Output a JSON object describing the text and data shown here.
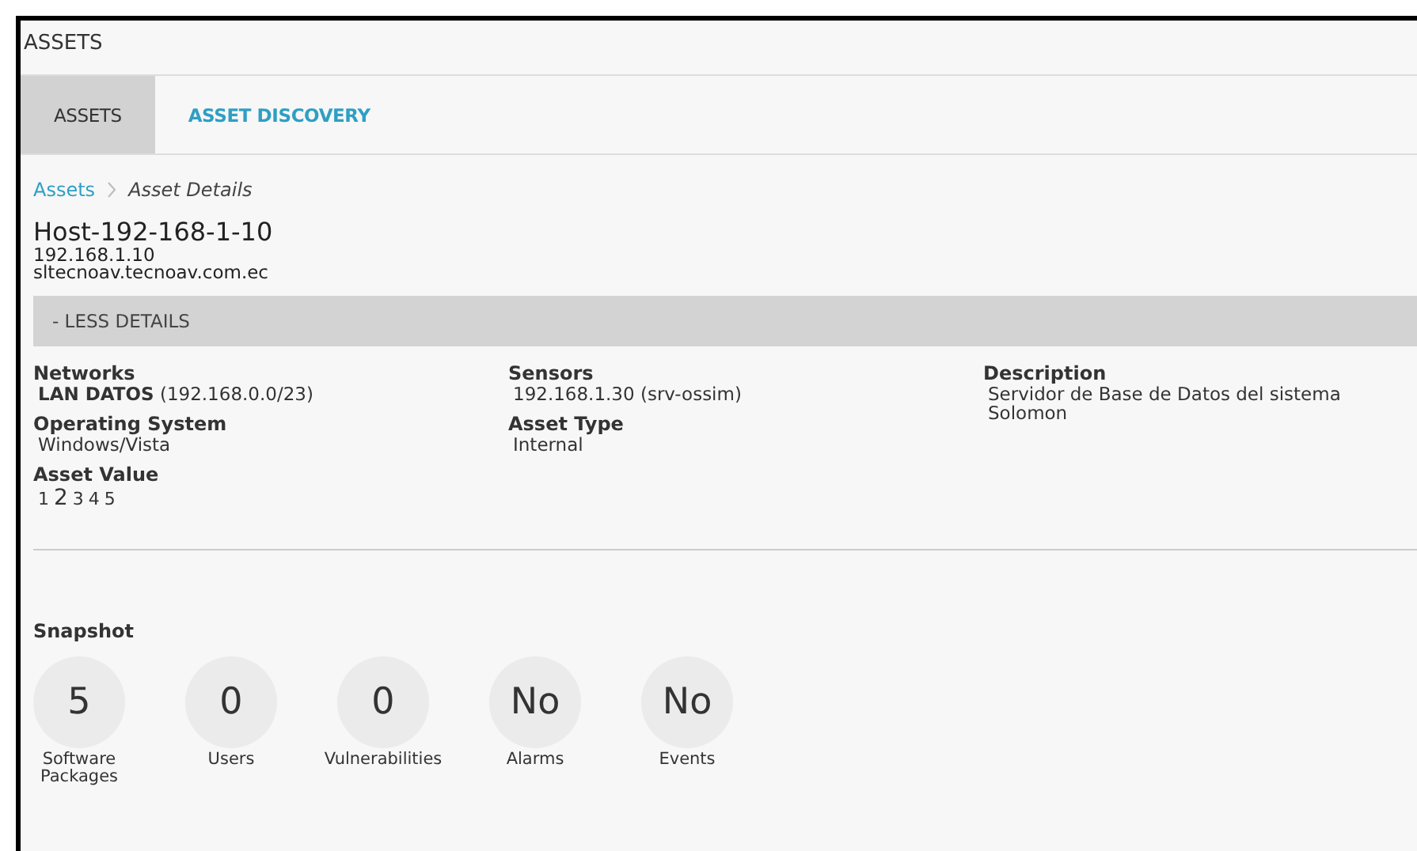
{
  "header": {
    "title": "ASSETS"
  },
  "tabs": [
    {
      "label": "ASSETS",
      "selected": true
    },
    {
      "label": "ASSET DISCOVERY",
      "selected": false
    }
  ],
  "breadcrumb": [
    {
      "label": "Assets",
      "kind": "link"
    },
    {
      "label": "Asset Details",
      "kind": "current"
    }
  ],
  "asset": {
    "name": "Host-192-168-1-10",
    "ip": "192.168.1.10",
    "fqdn": "sltecnoav.tecnoav.com.ec"
  },
  "details_toggle": {
    "label": "- LESS DETAILS"
  },
  "detail_columns": [
    [
      {
        "label": "Networks",
        "value": "**LAN DATOS** (192.168.0.0/23)"
      },
      {
        "label": "Operating System",
        "value": "Windows/Vista"
      }
    ],
    [
      {
        "label": "Sensors",
        "value": "192.168.1.30 (srv-ossim)"
      },
      {
        "label": "Asset Type",
        "value": "Internal"
      }
    ],
    [
      {
        "label": "Description",
        "value": "Servidor de Base de Datos del sistema Solomon"
      }
    ]
  ],
  "asset_value": {
    "label": "Asset Value",
    "options": [
      {
        "label": "1",
        "selected": false
      },
      {
        "label": "2",
        "selected": true
      },
      {
        "label": "3",
        "selected": false
      },
      {
        "label": "4",
        "selected": false
      },
      {
        "label": "5",
        "selected": false
      }
    ]
  },
  "snapshot": {
    "title": "Snapshot",
    "items": [
      {
        "value": "5",
        "label": "Software Packages"
      },
      {
        "value": "0",
        "label": "Users"
      },
      {
        "value": "0",
        "label": "Vulnerabilities"
      },
      {
        "value": "No",
        "label": "Alarms"
      },
      {
        "value": "No",
        "label": "Events"
      }
    ]
  }
}
